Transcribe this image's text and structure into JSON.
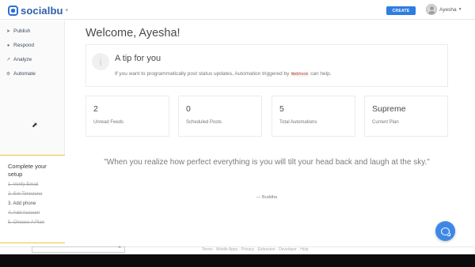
{
  "brand": {
    "name": "socialbu"
  },
  "header": {
    "create_label": "CREATE",
    "user_name": "Ayesha"
  },
  "sidebar": {
    "items": [
      {
        "label": "Publish",
        "icon": "paper-plane-icon"
      },
      {
        "label": "Respond",
        "icon": "chat-icon"
      },
      {
        "label": "Analyze",
        "icon": "chart-icon"
      },
      {
        "label": "Automate",
        "icon": "gears-icon"
      }
    ]
  },
  "setup": {
    "title": "Complete your setup",
    "steps": [
      {
        "label": "1. Verify Email",
        "done": true
      },
      {
        "label": "2. Set Timezone",
        "done": true
      },
      {
        "label": "3. Add phone",
        "done": false
      },
      {
        "label": "4. Add Account",
        "done": true
      },
      {
        "label": "5. Choose A Plan",
        "done": true
      }
    ]
  },
  "main": {
    "welcome": "Welcome, Ayesha!",
    "tip": {
      "badge": "i",
      "title": "A tip for you",
      "text_before": "If you want to programmatically post status updates, Automation triggered by",
      "code": "Webhook",
      "text_after": "can help."
    },
    "stats": [
      {
        "value": "2",
        "label": "Unread Feeds"
      },
      {
        "value": "0",
        "label": "Scheduled Posts"
      },
      {
        "value": "5",
        "label": "Total Automations"
      },
      {
        "value": "Supreme",
        "label": "Current Plan"
      }
    ],
    "quote": {
      "text": "\"When you realize how perfect everything is you will tilt your head back and laugh at the sky.\"",
      "author": "— Buddha"
    }
  },
  "footer": {
    "text": "Terms · Mobile Apps · Privacy · Extension · Developer · Help"
  },
  "colors": {
    "accent": "#2f7de1",
    "brand": "#2d5ea9",
    "setup_border": "#f3c13a",
    "chat": "#3d88e6"
  }
}
